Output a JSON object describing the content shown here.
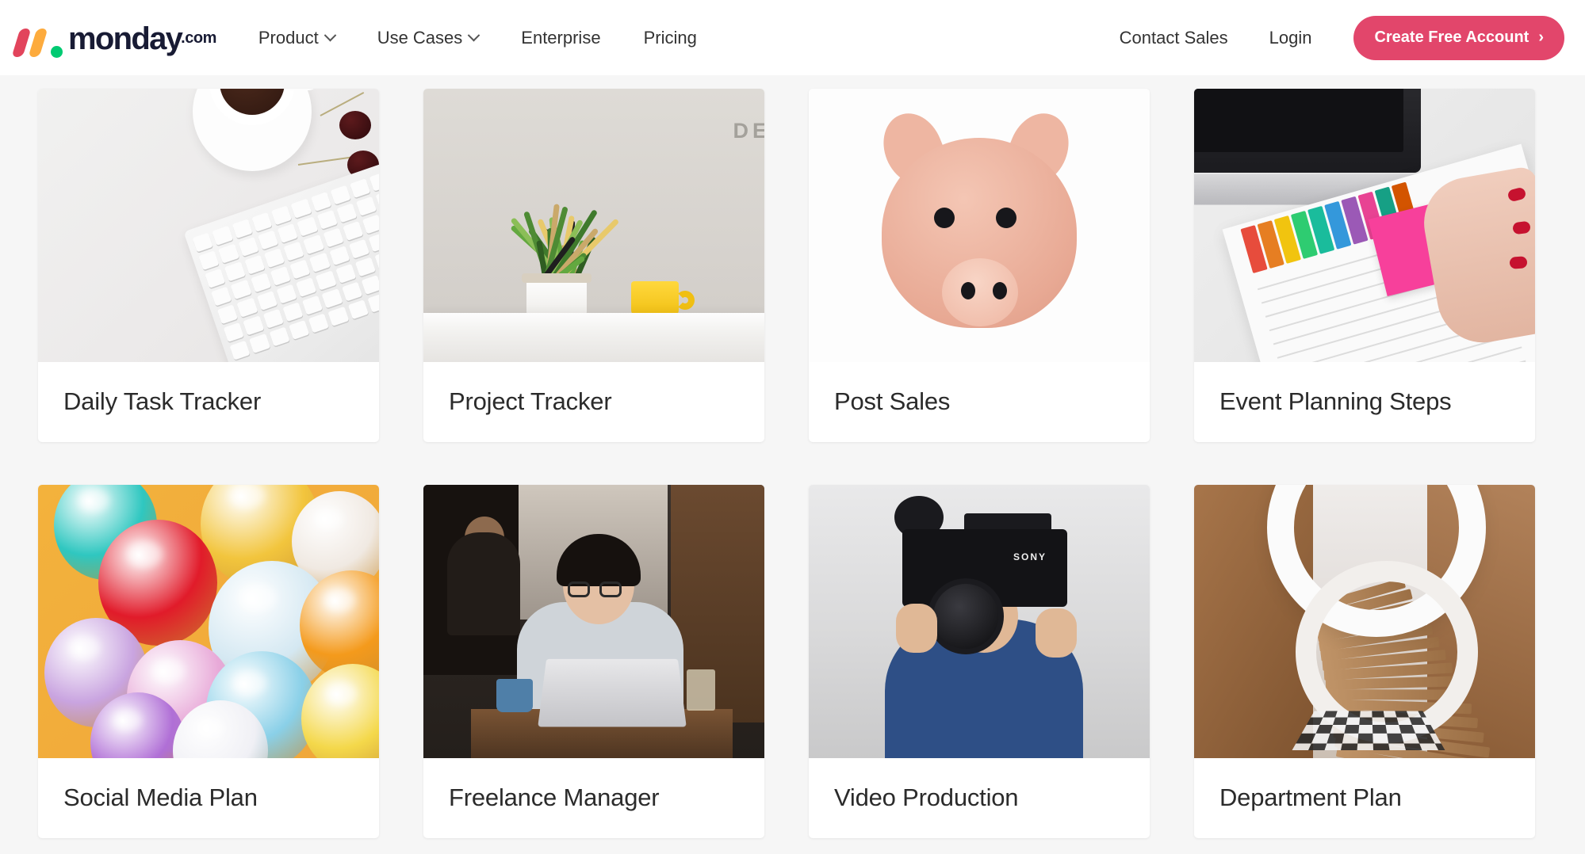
{
  "header": {
    "logo": {
      "brand": "monday",
      "suffix": ".com",
      "colors": {
        "mark1": "#e2445c",
        "mark2": "#fdab3d",
        "dot": "#00ca72",
        "word": "#181b34"
      }
    },
    "nav": [
      {
        "label": "Product",
        "has_chevron": true,
        "icon": "chevron-down-icon"
      },
      {
        "label": "Use Cases",
        "has_chevron": true,
        "icon": "chevron-down-icon"
      },
      {
        "label": "Enterprise",
        "has_chevron": false,
        "icon": ""
      },
      {
        "label": "Pricing",
        "has_chevron": false,
        "icon": ""
      }
    ],
    "contact_sales": "Contact Sales",
    "login": "Login",
    "cta": {
      "label": "Create Free Account",
      "arrow": "›",
      "color": "#e2466b"
    }
  },
  "templates": {
    "cards": [
      {
        "title": "Daily Task Tracker",
        "image": "desk-coffee-keyboard-cherries-photo"
      },
      {
        "title": "Project Tracker",
        "image": "plant-and-yellow-mug-on-shelf-photo",
        "wall_text": "DE"
      },
      {
        "title": "Post Sales",
        "image": "pink-piggy-bank-photo"
      },
      {
        "title": "Event Planning Steps",
        "image": "laptop-planner-colored-tabs-pink-note-photo"
      },
      {
        "title": "Social Media Plan",
        "image": "colorful-balloons-photo"
      },
      {
        "title": "Freelance Manager",
        "image": "person-working-on-laptop-in-cafe-photo"
      },
      {
        "title": "Video Production",
        "image": "videographer-with-sony-camera-photo",
        "camera_brand": "SONY"
      },
      {
        "title": "Department Plan",
        "image": "white-spiral-staircase-photo"
      }
    ]
  }
}
